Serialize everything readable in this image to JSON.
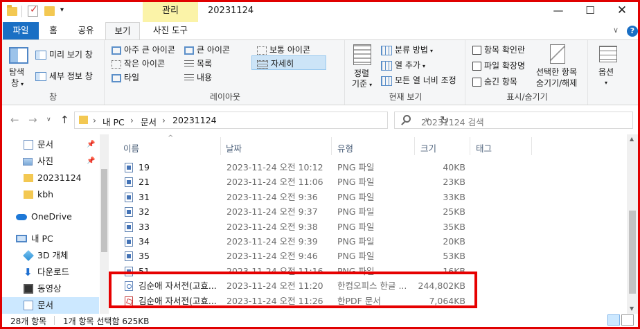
{
  "window": {
    "title": "20231124",
    "context_tab": "관리",
    "minimize": "—",
    "maximize": "☐",
    "close": "✕"
  },
  "tabs": {
    "file": "파일",
    "home": "홈",
    "share": "공유",
    "view": "보기",
    "picture_tools": "사진 도구",
    "collapse": "∨",
    "help": "?"
  },
  "ribbon": {
    "pane": {
      "nav_pane_line1": "탐색",
      "nav_pane_line2": "창",
      "preview": "미리 보기 창",
      "details": "세부 정보 창",
      "label": "창"
    },
    "layout": {
      "extra_large": "아주 큰 아이콘",
      "large": "큰 아이콘",
      "medium": "보통 아이콘",
      "small": "작은 아이콘",
      "list": "목록",
      "details": "자세히",
      "tiles": "타일",
      "content": "내용",
      "label": "레이아웃"
    },
    "current_view": {
      "sort_line1": "정렬",
      "sort_line2": "기준",
      "group_by": "분류 방법",
      "add_columns": "열 추가",
      "size_all_columns": "모든 열 너비 조정",
      "label": "현재 보기"
    },
    "show_hide": {
      "item_checkboxes": "항목 확인란",
      "file_extensions": "파일 확장명",
      "hidden_items": "숨긴 항목",
      "hide_selected_line1": "선택한 항목",
      "hide_selected_line2": "숨기기/해제",
      "label": "표시/숨기기"
    },
    "options": "옵션"
  },
  "address": {
    "crumbs": [
      "내 PC",
      "문서",
      "20231124"
    ],
    "separator": "›",
    "search_placeholder": "20231124 검색"
  },
  "nav_pane": {
    "items": [
      {
        "label": "문서",
        "pinned": true
      },
      {
        "label": "사진",
        "pinned": true
      },
      {
        "label": "20231124",
        "pinned": false
      },
      {
        "label": "kbh",
        "pinned": false
      },
      {
        "label": "OneDrive",
        "pinned": false
      },
      {
        "label": "내 PC",
        "pinned": false
      },
      {
        "label": "3D 개체",
        "pinned": false
      },
      {
        "label": "다운로드",
        "pinned": false
      },
      {
        "label": "동영상",
        "pinned": false
      },
      {
        "label": "문서",
        "pinned": false,
        "selected": true
      }
    ]
  },
  "columns": {
    "name": "이름",
    "date": "날짜",
    "type": "유형",
    "size": "크기",
    "tags": "태그"
  },
  "files": [
    {
      "name": "19",
      "date": "2023-11-24 오전 10:12",
      "type": "PNG 파일",
      "size": "40KB",
      "icon": "png"
    },
    {
      "name": "21",
      "date": "2023-11-24 오전 11:06",
      "type": "PNG 파일",
      "size": "23KB",
      "icon": "png"
    },
    {
      "name": "31",
      "date": "2023-11-24 오전 9:36",
      "type": "PNG 파일",
      "size": "33KB",
      "icon": "png"
    },
    {
      "name": "32",
      "date": "2023-11-24 오전 9:37",
      "type": "PNG 파일",
      "size": "25KB",
      "icon": "png"
    },
    {
      "name": "33",
      "date": "2023-11-24 오전 9:38",
      "type": "PNG 파일",
      "size": "35KB",
      "icon": "png"
    },
    {
      "name": "34",
      "date": "2023-11-24 오전 9:39",
      "type": "PNG 파일",
      "size": "20KB",
      "icon": "png"
    },
    {
      "name": "35",
      "date": "2023-11-24 오전 9:46",
      "type": "PNG 파일",
      "size": "53KB",
      "icon": "png"
    },
    {
      "name": "51",
      "date": "2023-11-24 오전 11:16",
      "type": "PNG 파일",
      "size": "16KB",
      "icon": "png"
    },
    {
      "name": "김순애 자서전(고효...",
      "date": "2023-11-24 오전 11:20",
      "type": "한컴오피스 한글 ...",
      "size": "244,802KB",
      "icon": "hwp"
    },
    {
      "name": "김순애 자서전(고효...",
      "date": "2023-11-24 오전 11:26",
      "type": "한PDF 문서",
      "size": "7,064KB",
      "icon": "pdf"
    }
  ],
  "status": {
    "item_count": "28개 항목",
    "selection": "1개 항목 선택함 625KB"
  },
  "colors": {
    "accent": "#1a6fc4",
    "context_tab": "#fbf3a8",
    "selection": "#cce8ff",
    "highlight": "#e60000"
  }
}
